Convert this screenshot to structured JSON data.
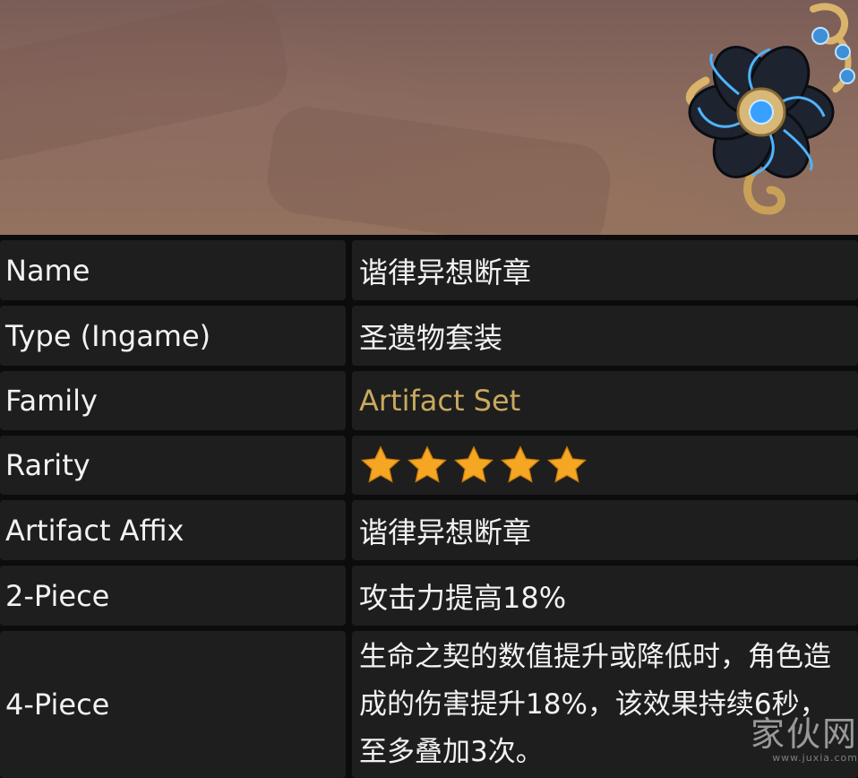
{
  "header": {
    "image_icon": "flower-of-life-artifact-icon"
  },
  "table": {
    "rows": [
      {
        "key": "Name",
        "value": "谐律异想断章"
      },
      {
        "key": "Type (Ingame)",
        "value": "圣遗物套装"
      },
      {
        "key": "Family",
        "value": "Artifact Set"
      },
      {
        "key": "Rarity",
        "value": "5",
        "icon": "star-icon"
      },
      {
        "key": "Artifact Affix",
        "value": "谐律异想断章"
      },
      {
        "key": "2-Piece",
        "value": "攻击力提高18%"
      },
      {
        "key": "4-Piece",
        "value": "生命之契的数值提升或降低时，角色造成的伤害提升18%，该效果持续6秒，至多叠加3次。"
      }
    ]
  },
  "rarity_stars": 5,
  "colors": {
    "link_gold": "#c9a95f",
    "star": "#f5a623",
    "cell_bg": "#1e1e1e"
  },
  "watermark": {
    "text": "家伙网",
    "sub": "www.juxia.com"
  }
}
